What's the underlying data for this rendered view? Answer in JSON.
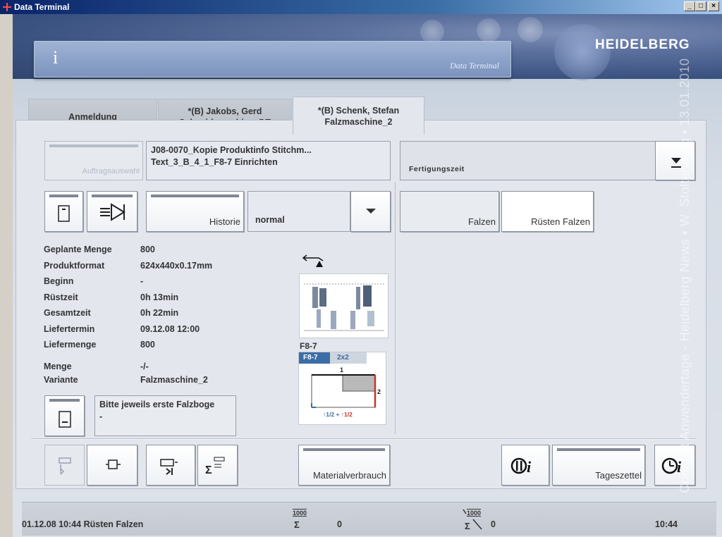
{
  "window": {
    "title": "Data Terminal",
    "controls": [
      "_",
      "□",
      "×"
    ]
  },
  "header": {
    "info_glyph": "i",
    "panel_label": "Data Terminal",
    "brand": "HEIDELBERG"
  },
  "tabs": [
    {
      "line1": "Anmeldung",
      "line2": "",
      "active": false
    },
    {
      "line1": "*(B) Jakobs, Gerd",
      "line2": "Schneidmaschine_DT",
      "active": false
    },
    {
      "line1": "*(B) Schenk, Stefan",
      "line2": "Falzmaschine_2",
      "active": true
    }
  ],
  "job": {
    "select_button_label": "Auftragsauswahl",
    "title_line1": "J08-0070_Kopie Produktinfo Stitchm...",
    "title_line2": "Text_3_B_4_1_F8-7 Einrichten"
  },
  "right_panel": {
    "dropdown_label": "Fertigungszeit"
  },
  "toolbar": {
    "history_label": "Historie",
    "mode_value": "normal",
    "falzen_label": "Falzen",
    "ruesten_label": "Rüsten Falzen"
  },
  "details": [
    {
      "key": "Geplante Menge",
      "value": "800"
    },
    {
      "key": "Produktformat",
      "value": "624x440x0.17mm"
    },
    {
      "key": "Beginn",
      "value": "-"
    },
    {
      "key": "Rüstzeit",
      "value": "0h 13min"
    },
    {
      "key": "Gesamtzeit",
      "value": "0h 22min"
    },
    {
      "key": "Liefertermin",
      "value": "09.12.08 12:00"
    },
    {
      "key": "Liefermenge",
      "value": "800"
    }
  ],
  "details2": [
    {
      "key": "Menge",
      "value": "-/-"
    },
    {
      "key": "Variante",
      "value": "Falzmaschine_2"
    }
  ],
  "scheme": {
    "label": "F8-7",
    "tab1": "F8-7",
    "tab2": "2x2",
    "num1": "1",
    "num2": "2",
    "caption_a": "↑1/2",
    "caption_plus": "+",
    "caption_b": "↑1/2"
  },
  "note": {
    "line1": "Bitte jeweils erste Falzboge",
    "line2": "-"
  },
  "bottom_bar": {
    "material_label": "Materialverbrauch",
    "tageszettel_label": "Tageszettel"
  },
  "status": {
    "message": "01.12.08 10:44 Rüsten Falzen",
    "counter1_label": "1000",
    "counter1_value": "0",
    "counter2_label": "1000",
    "counter2_value": "0",
    "time": "10:44"
  },
  "watermark": "Connect Anwendertage - Heidelberg News • W. Stoltenberg • 13.01.2010",
  "colors": {
    "titlebar": "#0a246a",
    "header": "#3a5280",
    "accent_red": "#c8342a",
    "scheme_blue": "#3a6ea5"
  }
}
